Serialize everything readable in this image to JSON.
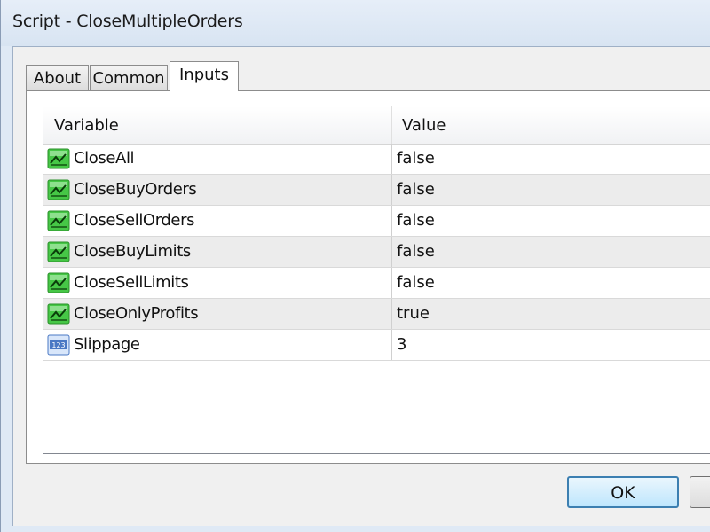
{
  "window": {
    "title": "Script - CloseMultipleOrders"
  },
  "tabs": [
    {
      "label": "About"
    },
    {
      "label": "Common"
    },
    {
      "label": "Inputs"
    }
  ],
  "table": {
    "headers": {
      "variable": "Variable",
      "value": "Value"
    },
    "rows": [
      {
        "variable": "CloseAll",
        "value": "false",
        "icon": "bool-param-icon"
      },
      {
        "variable": "CloseBuyOrders",
        "value": "false",
        "icon": "bool-param-icon"
      },
      {
        "variable": "CloseSellOrders",
        "value": "false",
        "icon": "bool-param-icon"
      },
      {
        "variable": "CloseBuyLimits",
        "value": "false",
        "icon": "bool-param-icon"
      },
      {
        "variable": "CloseSellLimits",
        "value": "false",
        "icon": "bool-param-icon"
      },
      {
        "variable": "CloseOnlyProfits",
        "value": "true",
        "icon": "bool-param-icon"
      },
      {
        "variable": "Slippage",
        "value": "3",
        "icon": "numeric-123-icon"
      }
    ]
  },
  "buttons": {
    "ok": "OK",
    "cancel": ""
  },
  "numeric_icon_text": "123",
  "colors": {
    "bool_icon": "#3fbf3f",
    "numeric_icon": "#4a78c4",
    "ok_border": "#3c7fb1"
  }
}
